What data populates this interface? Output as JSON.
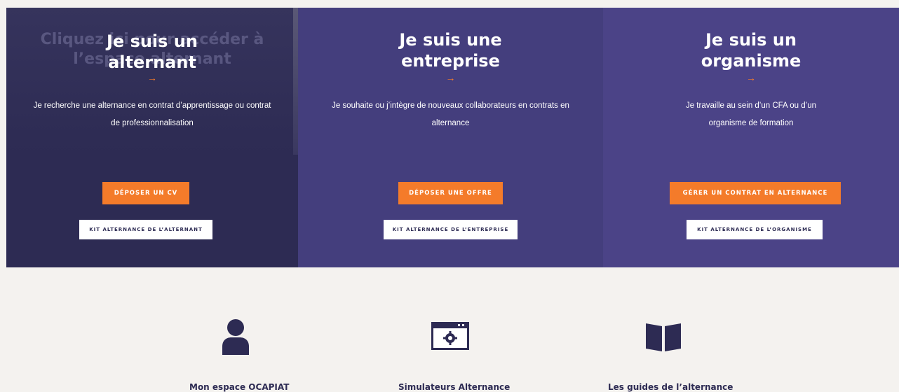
{
  "colors": {
    "panel_dark": "#2d2b53",
    "panel_mid": "#443e7d",
    "panel_light": "#4b4387",
    "accent_orange": "#f47b2a",
    "lower_bg": "#f4f2ef",
    "icon_navy": "#2d2b53"
  },
  "overlay": {
    "ghost_line1": "Cliquez ici pour accéder à",
    "ghost_line2": "l’espace alternant"
  },
  "panels": [
    {
      "title_line1": "Je suis un",
      "title_line2": "alternant",
      "arrow": "→",
      "description_line1": "Je recherche une alternance en contrat d’apprentissage ou contrat",
      "description_line2": "de professionnalisation",
      "primary_button": "Déposer un CV",
      "secondary_button": "Kit alternance de l’alternant"
    },
    {
      "title_line1": "Je suis une",
      "title_line2": "entreprise",
      "arrow": "→",
      "description_line1": "Je souhaite ou j’intègre de nouveaux collaborateurs en contrats en",
      "description_line2": "alternance",
      "primary_button": "Déposer une offre",
      "secondary_button": "Kit alternance de l’entreprise"
    },
    {
      "title_line1": "Je suis un",
      "title_line2": "organisme",
      "arrow": "→",
      "description_line1": "Je travaille au sein d’un CFA ou d’un",
      "description_line2": "organisme de formation",
      "primary_button": "Gérer un contrat en alternance",
      "secondary_button": "Kit alternance de l’organisme"
    }
  ],
  "resources": [
    {
      "icon": "user-icon",
      "label": "Mon espace OCAPIAT"
    },
    {
      "icon": "browser-gear-icon",
      "label": "Simulateurs Alternance"
    },
    {
      "icon": "open-book-icon",
      "label": "Les guides de l’alternance"
    }
  ]
}
